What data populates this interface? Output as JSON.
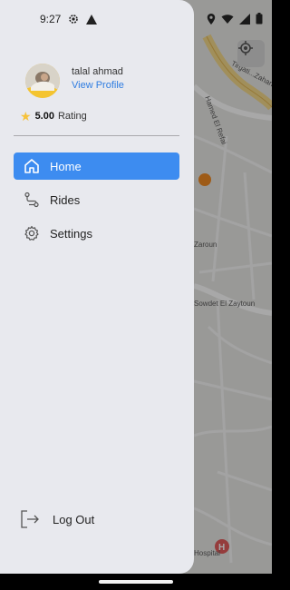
{
  "status_bar": {
    "time": "9:27"
  },
  "map": {
    "road_labels": [
      "Tirgati...Zaharia St",
      "Hamed El Refai",
      "Zaroun",
      "Sowdet El Zaytoun",
      "Hospital"
    ]
  },
  "drawer": {
    "user": {
      "name": "talal ahmad",
      "view_profile": "View Profile"
    },
    "rating": {
      "value": "5.00",
      "label": "Rating"
    },
    "menu": [
      {
        "label": "Home",
        "icon": "home-icon",
        "active": true
      },
      {
        "label": "Rides",
        "icon": "route-icon",
        "active": false
      },
      {
        "label": "Settings",
        "icon": "gear-icon",
        "active": false
      }
    ],
    "logout_label": "Log Out"
  },
  "colors": {
    "accent": "#3d8cf0",
    "link": "#2f7de1",
    "drawer_bg": "#e8e9ee",
    "star": "#f6c23a"
  }
}
